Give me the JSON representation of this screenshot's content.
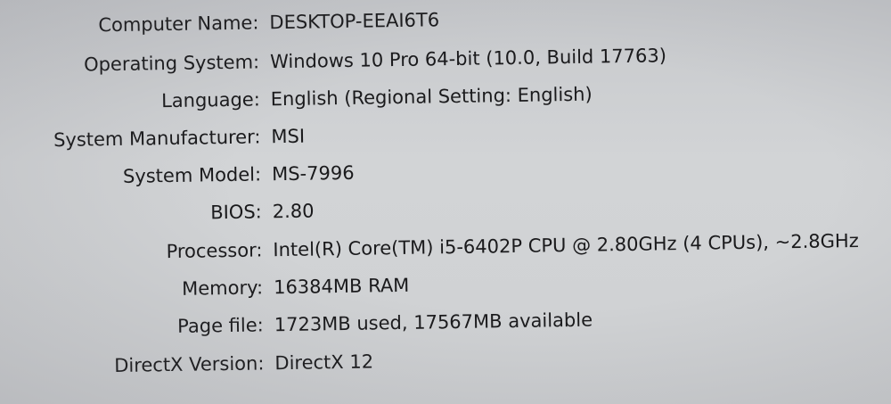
{
  "system_info": {
    "rows": [
      {
        "label": "Computer Name:",
        "value": "DESKTOP-EEAI6T6"
      },
      {
        "label": "Operating System:",
        "value": "Windows 10 Pro 64-bit (10.0, Build 17763)"
      },
      {
        "label": "Language:",
        "value": "English (Regional Setting: English)"
      },
      {
        "label": "System Manufacturer:",
        "value": "MSI"
      },
      {
        "label": "System Model:",
        "value": "MS-7996"
      },
      {
        "label": "BIOS:",
        "value": "2.80"
      },
      {
        "label": "Processor:",
        "value": "Intel(R) Core(TM) i5-6402P CPU @ 2.80GHz (4 CPUs), ~2.8GHz"
      },
      {
        "label": "Memory:",
        "value": "16384MB RAM"
      },
      {
        "label": "Page file:",
        "value": "1723MB used, 17567MB available"
      },
      {
        "label": "DirectX Version:",
        "value": "DirectX 12"
      }
    ]
  }
}
